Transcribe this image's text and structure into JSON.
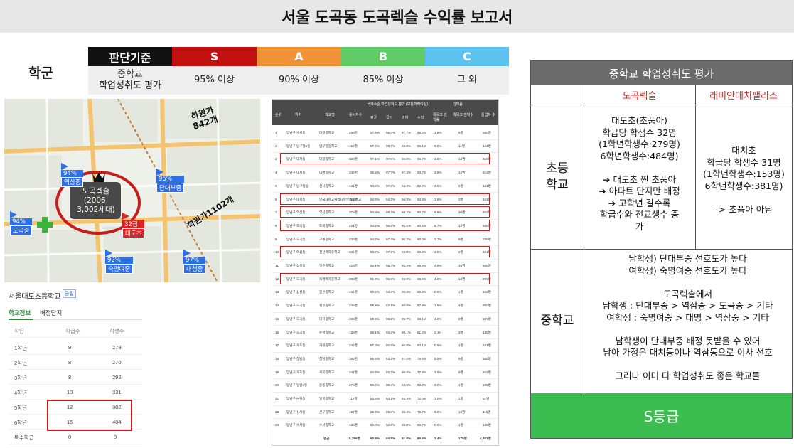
{
  "title": "서울 도곡동 도곡렉슬 수익률 보고서",
  "criteria": {
    "row_label": "학군",
    "header_label": "판단기준",
    "criterion_text": "중학교\n학업성취도 평가",
    "grades": [
      {
        "grade": "S",
        "value": "95% 이상",
        "color": "#c20f0f"
      },
      {
        "grade": "A",
        "value": "90% 이상",
        "color": "#ef9336"
      },
      {
        "grade": "B",
        "value": "85% 이상",
        "color": "#5fca66"
      },
      {
        "grade": "C",
        "value": "그 외",
        "color": "#5ec2ef"
      }
    ]
  },
  "map": {
    "labels": {
      "center": "도곡렉슬\n(2006,\n3,002세대)",
      "daewol": "하원가\n842개",
      "hakwon2": "학원가1102개",
      "gugwan": "32점"
    },
    "markers": [
      {
        "pct": "94%",
        "name": "역삼중"
      },
      {
        "pct": "95%",
        "name": "단대부중"
      },
      {
        "pct": "94%",
        "name": "도곡중"
      },
      {
        "pct": "32점",
        "name": "대도초"
      },
      {
        "pct": "92%",
        "name": "숙명여중"
      },
      {
        "pct": "97%",
        "name": "대청중"
      }
    ]
  },
  "school_info": {
    "name": "서울대도초등학교",
    "badge": "공립",
    "tabs": [
      "학교정보",
      "배정단지"
    ],
    "columns": [
      "학년",
      "학급수",
      "학생수"
    ],
    "rows": [
      [
        "1학년",
        "9",
        "279"
      ],
      [
        "2학년",
        "8",
        "270"
      ],
      [
        "3학년",
        "8",
        "292"
      ],
      [
        "4학년",
        "10",
        "331"
      ],
      [
        "5학년",
        "12",
        "382"
      ],
      [
        "6학년",
        "15",
        "484"
      ],
      [
        "특수학급",
        "0",
        "0"
      ]
    ]
  },
  "ranking_table": {
    "header": [
      "순위",
      "위치",
      "학교명",
      "응시자수",
      "평균",
      "국어",
      "영어",
      "수학",
      "특목고 진학률",
      "특목고 진학수",
      "졸업자 수"
    ],
    "header_group": "국가수준 학업성취도 평가 (보통학력이상)",
    "header_group2": "진학률",
    "rows": [
      [
        "1",
        "양남구 수서동",
        "대왕중학교",
        "290명",
        "97.6%",
        "99.0%",
        "97.7%",
        "96.2%",
        "1.8%",
        "5명",
        "260명"
      ],
      [
        "2",
        "양남구 압구정1동",
        "압구정중학교",
        "152명",
        "97.6%",
        "98.7%",
        "98.0%",
        "96.1%",
        "8.8%",
        "11명",
        "124명"
      ],
      [
        "3",
        "양남구 대치동",
        "대청중학교",
        "329명",
        "97.1%",
        "97.0%",
        "98.8%",
        "95.7%",
        "3.8%",
        "12명",
        "315명"
      ],
      [
        "4",
        "양남구 대치동",
        "대명중학교",
        "343명",
        "96.2%",
        "97.7%",
        "97.4%",
        "93.7%",
        "3.8%",
        "12명",
        "313명"
      ],
      [
        "5",
        "양남구 압구정동",
        "신사중학교",
        "141명",
        "94.8%",
        "97.2%",
        "94.3%",
        "92.9%",
        "3.5%",
        "5명",
        "141명"
      ],
      [
        "6",
        "양남구 대치동",
        "단국대학교사범대학부속중학교",
        "191명",
        "94.6%",
        "94.2%",
        "94.8%",
        "94.8%",
        "1.6%",
        "3명",
        "181명"
      ],
      [
        "7",
        "양남구 역삼동",
        "역삼중학교",
        "376명",
        "94.3%",
        "98.2%",
        "94.2%",
        "90.7%",
        "5.8%",
        "20명",
        "353명"
      ],
      [
        "8",
        "양남구 도곡동",
        "도곡중학교",
        "221명",
        "94.2%",
        "96.8%",
        "95.5%",
        "90.5%",
        "5.7%",
        "12명",
        "208명"
      ],
      [
        "9",
        "양남구 도곡동",
        "구룡중학교",
        "230명",
        "94.2%",
        "97.4%",
        "95.2%",
        "90.0%",
        "3.7%",
        "9명",
        "239명"
      ],
      [
        "10",
        "양남구 역삼동",
        "진선여자중학교",
        "334명",
        "93.7%",
        "97.3%",
        "94.0%",
        "89.8%",
        "2.8%",
        "9명",
        "321명"
      ],
      [
        "11",
        "양남구 삼성동",
        "언주중학교",
        "325명",
        "92.1%",
        "95.7%",
        "93.9%",
        "86.8%",
        "4.9%",
        "15명",
        "306명"
      ],
      [
        "12",
        "양남구 도곡동",
        "숙명여자중학교",
        "283명",
        "91.8%",
        "96.8%",
        "92.9%",
        "85.9%",
        "4.2%",
        "12명",
        "283명"
      ],
      [
        "13",
        "양남구 삼성동",
        "봉은중학교",
        "144명",
        "90.5%",
        "94.4%",
        "90.3%",
        "86.8%",
        "0.9%",
        "1명",
        "102명"
      ],
      [
        "14",
        "양남구 도곡동",
        "휘문중학교",
        "245명",
        "89.9%",
        "92.1%",
        "89.8%",
        "87.9%",
        "1.5%",
        "4명",
        "260명"
      ],
      [
        "15",
        "양남구 도곡동",
        "대치중학교",
        "195명",
        "88.5%",
        "93.8%",
        "89.7%",
        "82.1%",
        "4.2%",
        "8명",
        "187명"
      ],
      [
        "16",
        "양남구 도곡동",
        "윤성중학교",
        "138명",
        "88.1%",
        "94.2%",
        "89.1%",
        "81.2%",
        "2.1%",
        "3명",
        "138명"
      ],
      [
        "17",
        "양남구 개포동",
        "개원중학교",
        "247명",
        "87.0%",
        "92.9%",
        "85.0%",
        "83.1%",
        "0.5%",
        "1명",
        "181명"
      ],
      [
        "18",
        "양남구 청담동",
        "청담중학교",
        "162명",
        "85.6%",
        "93.2%",
        "87.0%",
        "76.6%",
        "5.5%",
        "9명",
        "165명"
      ],
      [
        "19",
        "양남구 개포동",
        "세곡중학교",
        "247명",
        "84.6%",
        "92.7%",
        "88.8%",
        "72.9%",
        "3.0%",
        "8명",
        "263명"
      ],
      [
        "20",
        "양남구 일원2동",
        "중동중학교",
        "275명",
        "84.6%",
        "89.4%",
        "83.5%",
        "82.2%",
        "2.0%",
        "4명",
        "199명"
      ],
      [
        "21",
        "양남구 논현동",
        "언북중학교",
        "116명",
        "83.3%",
        "94.1%",
        "83.9%",
        "72.0%",
        "1.0%",
        "1명",
        "91명"
      ],
      [
        "22",
        "양남구 신사동",
        "신구중학교",
        "127명",
        "82.6%",
        "89.0%",
        "80.3%",
        "78.7%",
        "8.6%",
        "10명",
        "115명"
      ],
      [
        "23",
        "양남구 수서동",
        "수서중학교",
        "135명",
        "80.0%",
        "92.6%",
        "80.0%",
        "66.7%",
        "0.6%",
        "1명",
        "149명"
      ]
    ],
    "total": [
      "평균",
      "5,296명",
      "90.5%",
      "94.9%",
      "91.0%",
      "85.6%",
      "3.4%",
      "175명",
      "4,881명"
    ],
    "highlighted_ranks": [
      "3",
      "6",
      "7",
      "8",
      "10",
      "12"
    ]
  },
  "evaluation": {
    "header": "중학교 학업성취도 평가",
    "col1": "도곡렉슬",
    "col2": "래미안대치팰리스",
    "elementary_label": "초등\n학교",
    "elementary_col1": "대도초(초품아)\n학급당 학생수 32명\n(1학년학생수:279명)\n6학년학생수:484명)\n\n➔ 대도초 찐 초품아\n➔ 아파트 단지만 배정\n➔ 고학년 갈수록\n학급수와 전교생수 증\n가",
    "elementary_col2": "대치초\n학급당 학생수 31명\n(1학년학생수:153명)\n6학년학생수:381명)\n\n-> 초품아 아님",
    "middle_label": "중학교",
    "middle_text": "남학생) 단대부중 선호도가 높다\n여학생) 숙명여중 선호도가 높다\n\n도곡렉슬에서\n남학생 : 단대부중 > 역삼중 > 도곡중 > 기타\n여학생 : 숙명여중 > 대명 > 역삼중 > 기타\n\n남학생이 단대부중 배정 못받을 수 있어\n남아 가정은 대치동이나 역삼동으로 이사 선호\n\n그러나 이미 다 학업성취도 좋은 학교들",
    "grade": "S등급",
    "grade_color": "#3bbd4f"
  }
}
